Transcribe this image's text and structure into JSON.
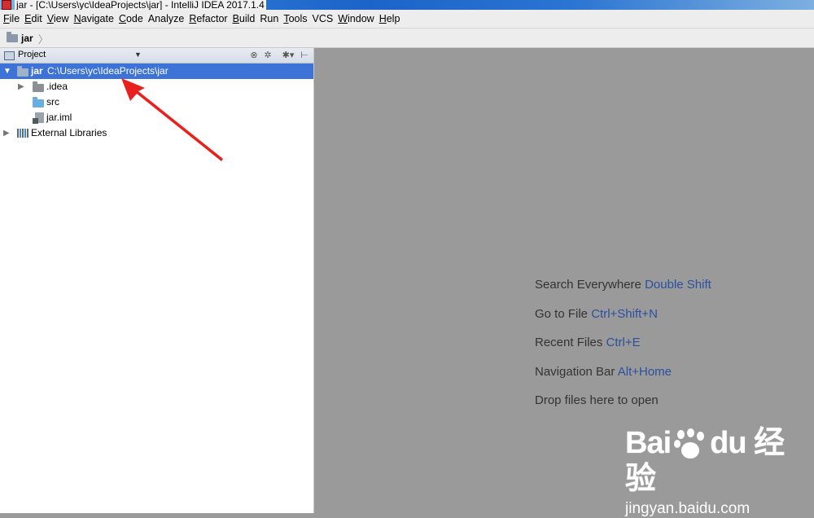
{
  "window": {
    "title": "jar - [C:\\Users\\yc\\IdeaProjects\\jar] - IntelliJ IDEA 2017.1.4"
  },
  "menu": [
    {
      "mnemonic": "F",
      "rest": "ile"
    },
    {
      "mnemonic": "E",
      "rest": "dit"
    },
    {
      "mnemonic": "V",
      "rest": "iew"
    },
    {
      "mnemonic": "N",
      "rest": "avigate"
    },
    {
      "mnemonic": "C",
      "rest": "ode"
    },
    {
      "mnemonic": "",
      "rest": "Analyze"
    },
    {
      "mnemonic": "R",
      "rest": "efactor"
    },
    {
      "mnemonic": "B",
      "rest": "uild"
    },
    {
      "mnemonic": "",
      "rest": "Run"
    },
    {
      "mnemonic": "T",
      "rest": "ools"
    },
    {
      "mnemonic": "",
      "rest": "VCS"
    },
    {
      "mnemonic": "W",
      "rest": "indow"
    },
    {
      "mnemonic": "H",
      "rest": "elp"
    }
  ],
  "breadcrumb": {
    "label": "jar",
    "icon": "module-folder-icon"
  },
  "project_panel": {
    "title": "Project",
    "tree": [
      {
        "label": "jar",
        "path": "C:\\Users\\yc\\IdeaProjects\\jar",
        "expanded": true,
        "selected": true,
        "icon": "module-folder-icon"
      },
      {
        "label": ".idea",
        "expanded": false,
        "icon": "folder-icon"
      },
      {
        "label": "src",
        "icon": "source-folder-icon"
      },
      {
        "label": "jar.iml",
        "icon": "iml-file-icon"
      },
      {
        "label": "External Libraries",
        "expanded": false,
        "icon": "libraries-icon"
      }
    ]
  },
  "editor_hints": [
    {
      "text": "Search Everywhere",
      "shortcut": "Double Shift"
    },
    {
      "text": "Go to File",
      "shortcut": "Ctrl+Shift+N"
    },
    {
      "text": "Recent Files",
      "shortcut": "Ctrl+E"
    },
    {
      "text": "Navigation Bar",
      "shortcut": "Alt+Home"
    },
    {
      "text": "Drop files here to open",
      "shortcut": ""
    }
  ],
  "watermark": {
    "logo_text_1": "Bai",
    "logo_text_2": "du",
    "logo_text_3": "经验",
    "url": "jingyan.baidu.com"
  },
  "colors": {
    "selection": "#3d73d6",
    "editor_bg": "#9a9a9a",
    "shortcut": "#2c4fa0",
    "annotation_arrow": "#e8211e"
  }
}
